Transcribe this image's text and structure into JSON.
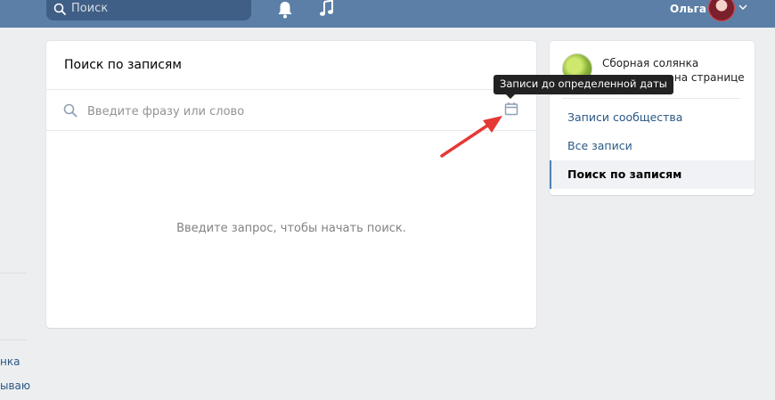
{
  "header": {
    "search_placeholder": "Поиск",
    "username": "Ольга",
    "icons": [
      "search-icon",
      "bell-icon",
      "music-icon",
      "chevron-down-icon"
    ]
  },
  "left_cut": {
    "line1": "нка",
    "line2": "ываю"
  },
  "main": {
    "title": "Поиск по записям",
    "search_placeholder": "Введите фразу или слово",
    "empty_message": "Введите запрос, чтобы начать поиск.",
    "tooltip": "Записи до определенной даты"
  },
  "sidebar": {
    "group_name": "Сборная солянка вконтакте и на странице",
    "items": [
      {
        "label": "Записи сообщества"
      },
      {
        "label": "Все записи"
      },
      {
        "label": "Поиск по записям"
      }
    ],
    "active_index": 2
  },
  "colors": {
    "header_bg": "#5b7fa6",
    "page_bg": "#edeef0",
    "link": "#2a5885",
    "tooltip_bg": "#222222",
    "arrow": "#e53935"
  }
}
